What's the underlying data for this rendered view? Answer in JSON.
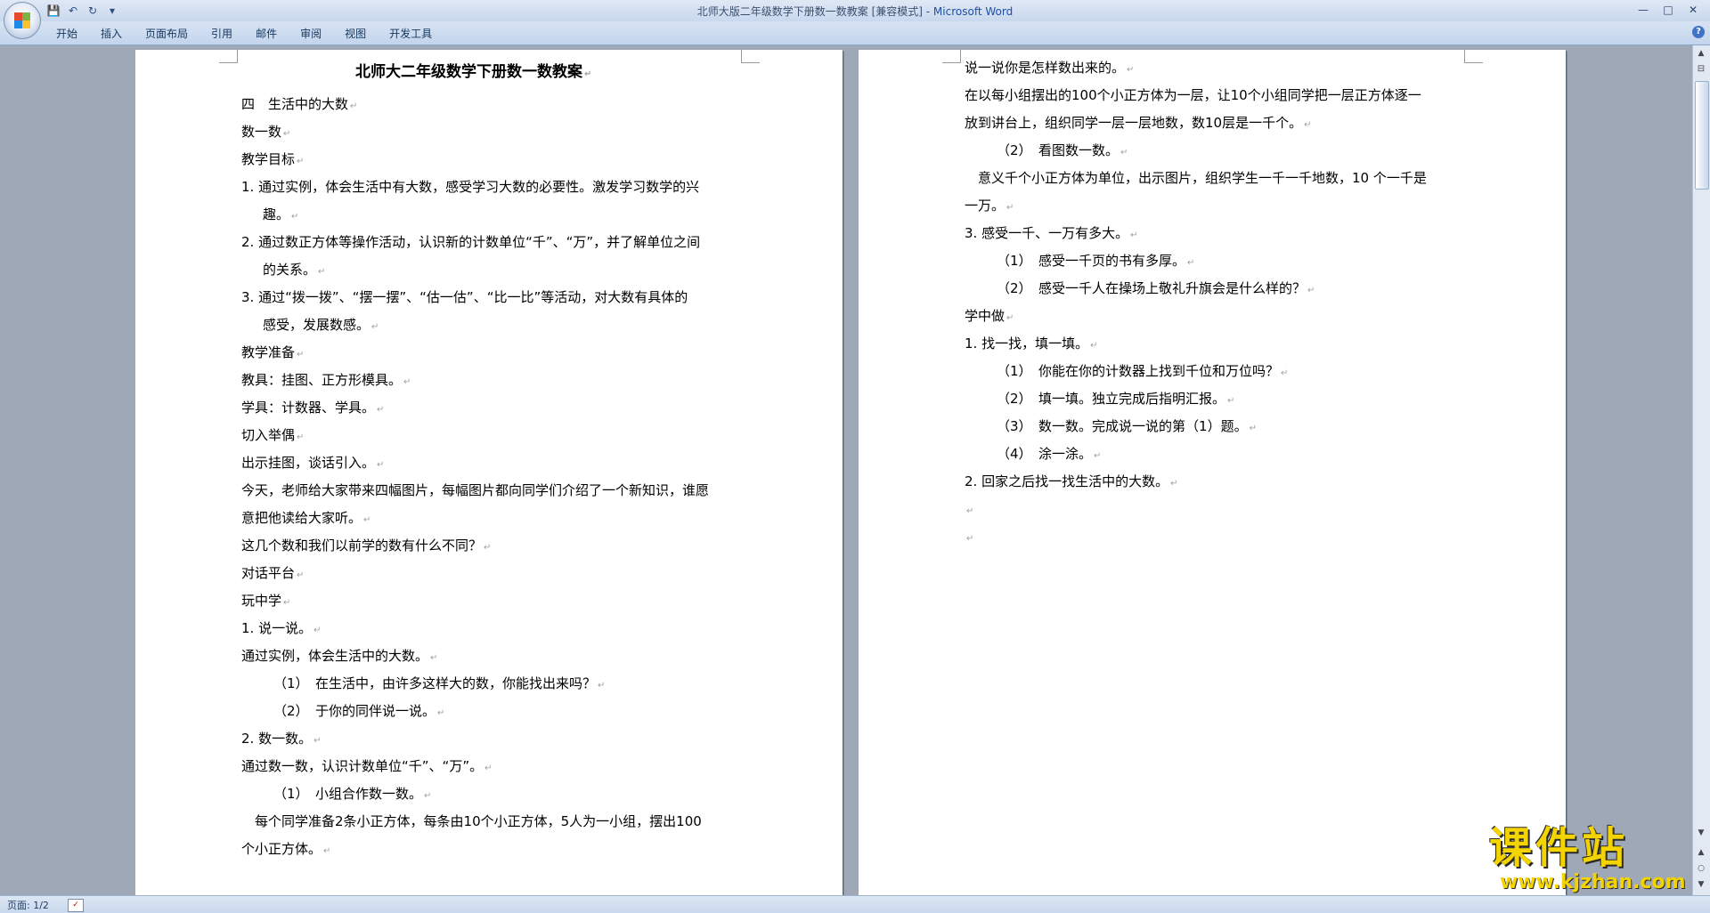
{
  "window": {
    "title_prefix": "北师大版二年级数学下册数一数教案 [兼容模式] - ",
    "title_app": "Microsoft Word",
    "controls": [
      "—",
      "□",
      "✕"
    ]
  },
  "quick_access": {
    "save": "💾",
    "undo": "↶",
    "redo": "↻",
    "customize": "▾"
  },
  "ribbon": {
    "tabs": [
      "开始",
      "插入",
      "页面布局",
      "引用",
      "邮件",
      "审阅",
      "视图",
      "开发工具"
    ],
    "help": "?"
  },
  "office_logo_colors": [
    "#e8482c",
    "#7cb342",
    "#1e88e5",
    "#fbc02d"
  ],
  "paragraph_mark": "↵",
  "page1": {
    "title": "北师大二年级数学下册数一数教案",
    "lines": [
      "四　生活中的大数",
      "数一数",
      "教学目标",
      "1. 通过实例，体会生活中有大数，感受学习大数的必要性。激发学习数学的兴",
      "趣。",
      "2. 通过数正方体等操作活动，认识新的计数单位“千”、“万”，并了解单位之间",
      "的关系。",
      "3. 通过“拨一拨”、“摆一摆”、“估一估”、“比一比”等活动，对大数有具体的",
      "感受，发展数感。",
      "教学准备",
      "教具：挂图、正方形模具。",
      "学具：计数器、学具。",
      "切入举偶",
      "出示挂图，谈话引入。",
      "今天，老师给大家带来四幅图片，每幅图片都向同学们介绍了一个新知识，谁愿",
      "意把他读给大家听。",
      "这几个数和我们以前学的数有什么不同？",
      "对话平台",
      "玩中学",
      "1. 说一说。",
      "通过实例，体会生活中的大数。",
      "（1）　在生活中，由许多这样大的数，你能找出来吗？",
      "（2）　于你的同伴说一说。",
      "2. 数一数。",
      "通过数一数，认识计数单位“千”、“万”。",
      "（1）　小组合作数一数。",
      "　每个同学准备2条小正方体，每条由10个小正方体，5人为一小组，摆出100",
      "个小正方体。"
    ]
  },
  "page2": {
    "lines": [
      "说一说你是怎样数出来的。",
      "在以每小组摆出的100个小正方体为一层，让10个小组同学把一层正方体逐一",
      "放到讲台上，组织同学一层一层地数，数10层是一千个。",
      "（2）　看图数一数。",
      "　意义千个小正方体为单位，出示图片，组织学生一千一千地数，10 个一千是",
      "一万。",
      "3. 感受一千、一万有多大。",
      "（1）　感受一千页的书有多厚。",
      "（2）　感受一千人在操场上敬礼升旗会是什么样的？",
      "学中做",
      "1. 找一找，填一填。",
      "（1）　你能在你的计数器上找到千位和万位吗？",
      "（2）　填一填。独立完成后指明汇报。",
      "（3）　数一数。完成说一说的第（1）题。",
      "（4）　涂一涂。",
      "2. 回家之后找一找生活中的大数。",
      "",
      ""
    ]
  },
  "scrollbar": {
    "up": "▲",
    "ruler": "⊟",
    "down": "▼",
    "prev": "▲",
    "browse": "○",
    "next": "▼"
  },
  "watermark": {
    "main": "课件站",
    "url": "www.kjzhan.com"
  },
  "status": {
    "page": "页面: 1/2",
    "proofing_icon": "✓"
  }
}
